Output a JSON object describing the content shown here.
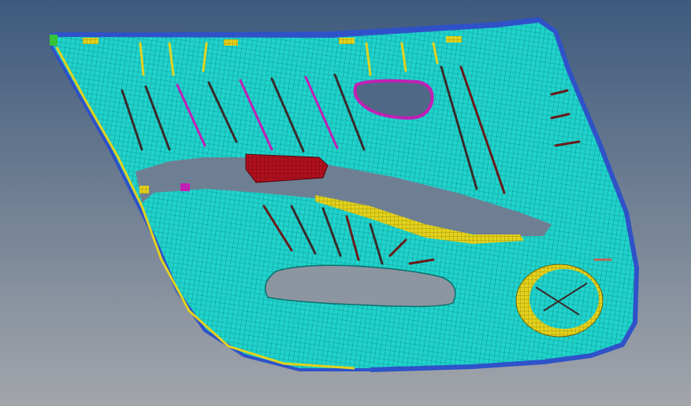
{
  "viewport": {
    "background_top": "#3e5a7d",
    "background_bottom": "#a3a6ab"
  },
  "model": {
    "colors": {
      "panel_mesh": "#1fd3cc",
      "mesh_lines": "#0c6f6c",
      "border": "#2f52c9",
      "clip_yellow": "#e3d21c",
      "rib_dark": "#3a2a2a",
      "rib_magenta": "#c21fb5",
      "bracket_red": "#b0101e",
      "speaker_yellow": "#d8cc1a"
    }
  }
}
